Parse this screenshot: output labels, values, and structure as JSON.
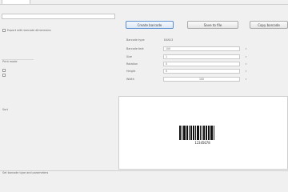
{
  "top_field": {
    "value": ""
  },
  "options": {
    "checkbox_label": "Export with barcode dimensions"
  },
  "side_panel": {
    "group1_label": "Print mode",
    "group2_label": "Sort"
  },
  "buttons": {
    "generate": "Create barcode",
    "save_file": "Save to file",
    "copy": "Copy barcode"
  },
  "settings": [
    {
      "label": "Barcode type",
      "value": "EAN13"
    },
    {
      "label": "Barcode text",
      "value": "100"
    },
    {
      "label": "Size",
      "value": "1"
    },
    {
      "label": "Rotation",
      "value": "0"
    },
    {
      "label": "Height",
      "value": "0"
    },
    {
      "label": "Width",
      "value": "100"
    }
  ],
  "preview": {
    "barcode_text": "12345678"
  },
  "status": {
    "text": "Set barcode type and parameters"
  }
}
